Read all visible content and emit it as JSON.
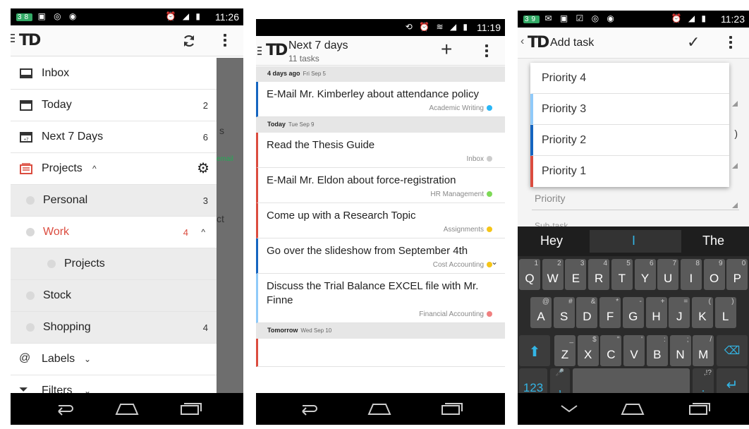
{
  "phone1": {
    "status_time": "11:26",
    "status_left": "38",
    "drawer_items": [
      {
        "label": "Inbox",
        "count": "",
        "icon": "inbox-icon"
      },
      {
        "label": "Today",
        "count": "2",
        "icon": "calendar-today-icon"
      },
      {
        "label": "Next 7 Days",
        "count": "6",
        "icon": "calendar-week-icon"
      },
      {
        "label": "Projects",
        "count": "",
        "icon": "projects-icon"
      }
    ],
    "calendar_badge": "+7",
    "projects": [
      {
        "label": "Personal",
        "count": "3"
      },
      {
        "label": "Work",
        "count": "4"
      },
      {
        "label": "Projects",
        "count": ""
      },
      {
        "label": "Stock",
        "count": ""
      },
      {
        "label": "Shopping",
        "count": "4"
      }
    ],
    "labels_item": "Labels",
    "filters_item": "Filters",
    "backdrop_fragments": [
      "s",
      "email",
      "ct"
    ],
    "accent": "#db4c3f"
  },
  "phone2": {
    "status_time": "11:19",
    "title": "Next 7 days",
    "subtitle": "11 tasks",
    "sections": [
      {
        "heading": "4 days ago",
        "date": "Fri Sep 5",
        "tasks": [
          {
            "text": "E-Mail Mr. Kimberley about attendance policy",
            "project": "Academic Writing",
            "color": "#29b6f6",
            "bar": "#1565c0"
          }
        ]
      },
      {
        "heading": "Today",
        "date": "Tue Sep 9",
        "tasks": [
          {
            "text": "Read the Thesis Guide",
            "project": "Inbox",
            "color": "#cccccc",
            "bar": "#db4c3f"
          },
          {
            "text": "E-Mail Mr. Eldon about force-registration",
            "project": "HR Management",
            "color": "#7ed957",
            "bar": "#db4c3f"
          },
          {
            "text": "Come up with a Research Topic",
            "project": "Assignments",
            "color": "#f5c518",
            "bar": "#db4c3f"
          },
          {
            "text": "Go over the slideshow from September 4th",
            "project": "Cost Accounting",
            "color": "#f5c518",
            "bar": "#1565c0"
          },
          {
            "text": "Discuss the Trial Balance EXCEL file with Mr. Finne",
            "project": "Financial Accounting",
            "color": "#f08080",
            "bar": "#90caf9"
          }
        ]
      },
      {
        "heading": "Tomorrow",
        "date": "Wed Sep 10",
        "tasks": []
      }
    ]
  },
  "phone3": {
    "status_time": "11:23",
    "status_left": "39",
    "title": "Add task",
    "priority_options": [
      {
        "label": "Priority 4",
        "color": "#ffffff"
      },
      {
        "label": "Priority 3",
        "color": "#90caf9"
      },
      {
        "label": "Priority 2",
        "color": "#1565c0"
      },
      {
        "label": "Priority 1",
        "color": "#db4c3f"
      }
    ],
    "priority_field_label": "Priority",
    "subtask_label": "Sub-task",
    "suggestions": [
      "Hey",
      "I",
      "The"
    ],
    "row1": [
      [
        "Q",
        "1"
      ],
      [
        "W",
        "2"
      ],
      [
        "E",
        "3"
      ],
      [
        "R",
        "4"
      ],
      [
        "T",
        "5"
      ],
      [
        "Y",
        "6"
      ],
      [
        "U",
        "7"
      ],
      [
        "I",
        "8"
      ],
      [
        "O",
        "9"
      ],
      [
        "P",
        "0"
      ]
    ],
    "row2": [
      [
        "A",
        "@"
      ],
      [
        "S",
        "#"
      ],
      [
        "D",
        "&"
      ],
      [
        "F",
        "*"
      ],
      [
        "G",
        "-"
      ],
      [
        "H",
        "+"
      ],
      [
        "J",
        "="
      ],
      [
        "K",
        "("
      ],
      [
        "L",
        ")"
      ]
    ],
    "row3": [
      [
        "Z",
        "_"
      ],
      [
        "X",
        "$"
      ],
      [
        "C",
        "\""
      ],
      [
        "V",
        "'"
      ],
      [
        "B",
        ":"
      ],
      [
        "N",
        ";"
      ],
      [
        "M",
        "/"
      ]
    ],
    "key_123": "123",
    "key_comma": ",",
    "key_period": ".",
    "key_punct": ",!?"
  }
}
